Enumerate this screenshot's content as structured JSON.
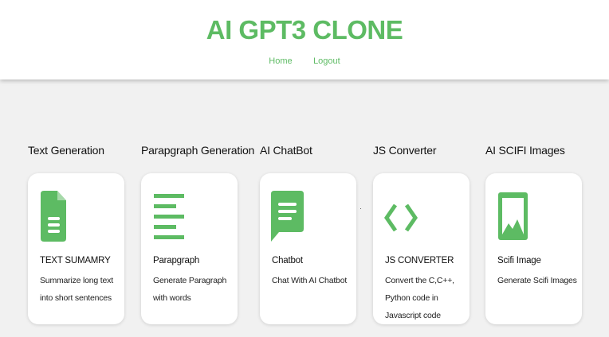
{
  "header": {
    "title": "AI GPT3 CLONE",
    "nav": [
      "Home",
      "Logout"
    ]
  },
  "colors": {
    "accent": "#5dbb63",
    "background": "#f1f1f1",
    "card": "#ffffff"
  },
  "tools": [
    {
      "section": "Text Generation",
      "icon": "document-icon",
      "name": "TEXT SUMAMRY",
      "description": "Summarize long text into short sentences"
    },
    {
      "section": "Parapgraph Generation",
      "icon": "paragraph-lines-icon",
      "name": "Parapgraph",
      "description": "Generate Paragraph with words"
    },
    {
      "section": "AI ChatBot",
      "icon": "chat-bubble-icon",
      "name": "Chatbot",
      "description": "Chat With AI Chatbot"
    },
    {
      "section": "JS Converter",
      "icon": "code-brackets-icon",
      "name": "JS CONVERTER",
      "description": "Convert the C,C++, Python code in Javascript code"
    },
    {
      "section": "AI SCIFI Images",
      "icon": "image-icon",
      "name": "Scifi Image",
      "description": "Generate Scifi Images"
    }
  ]
}
